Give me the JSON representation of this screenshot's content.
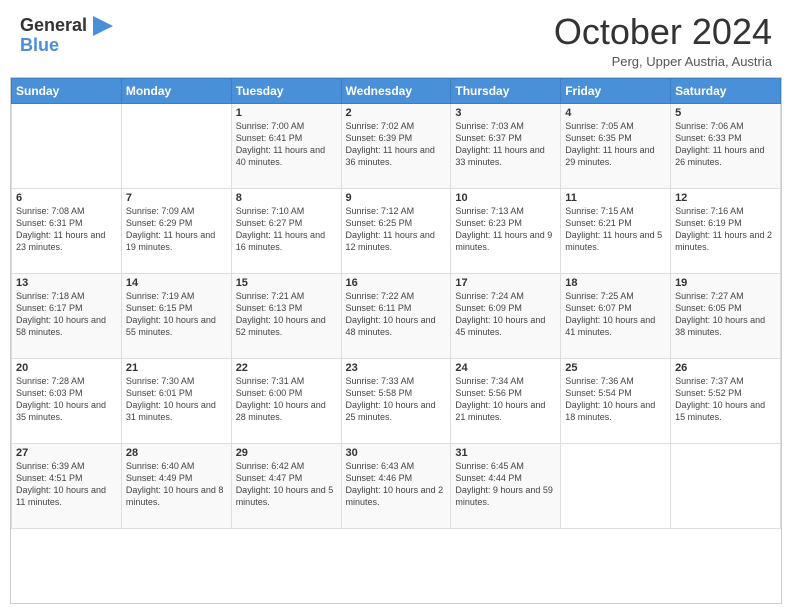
{
  "header": {
    "logo_general": "General",
    "logo_blue": "Blue",
    "title": "October 2024",
    "subtitle": "Perg, Upper Austria, Austria"
  },
  "calendar": {
    "days_of_week": [
      "Sunday",
      "Monday",
      "Tuesday",
      "Wednesday",
      "Thursday",
      "Friday",
      "Saturday"
    ],
    "weeks": [
      [
        {
          "day": "",
          "info": ""
        },
        {
          "day": "",
          "info": ""
        },
        {
          "day": "1",
          "info": "Sunrise: 7:00 AM\nSunset: 6:41 PM\nDaylight: 11 hours and 40 minutes."
        },
        {
          "day": "2",
          "info": "Sunrise: 7:02 AM\nSunset: 6:39 PM\nDaylight: 11 hours and 36 minutes."
        },
        {
          "day": "3",
          "info": "Sunrise: 7:03 AM\nSunset: 6:37 PM\nDaylight: 11 hours and 33 minutes."
        },
        {
          "day": "4",
          "info": "Sunrise: 7:05 AM\nSunset: 6:35 PM\nDaylight: 11 hours and 29 minutes."
        },
        {
          "day": "5",
          "info": "Sunrise: 7:06 AM\nSunset: 6:33 PM\nDaylight: 11 hours and 26 minutes."
        }
      ],
      [
        {
          "day": "6",
          "info": "Sunrise: 7:08 AM\nSunset: 6:31 PM\nDaylight: 11 hours and 23 minutes."
        },
        {
          "day": "7",
          "info": "Sunrise: 7:09 AM\nSunset: 6:29 PM\nDaylight: 11 hours and 19 minutes."
        },
        {
          "day": "8",
          "info": "Sunrise: 7:10 AM\nSunset: 6:27 PM\nDaylight: 11 hours and 16 minutes."
        },
        {
          "day": "9",
          "info": "Sunrise: 7:12 AM\nSunset: 6:25 PM\nDaylight: 11 hours and 12 minutes."
        },
        {
          "day": "10",
          "info": "Sunrise: 7:13 AM\nSunset: 6:23 PM\nDaylight: 11 hours and 9 minutes."
        },
        {
          "day": "11",
          "info": "Sunrise: 7:15 AM\nSunset: 6:21 PM\nDaylight: 11 hours and 5 minutes."
        },
        {
          "day": "12",
          "info": "Sunrise: 7:16 AM\nSunset: 6:19 PM\nDaylight: 11 hours and 2 minutes."
        }
      ],
      [
        {
          "day": "13",
          "info": "Sunrise: 7:18 AM\nSunset: 6:17 PM\nDaylight: 10 hours and 58 minutes."
        },
        {
          "day": "14",
          "info": "Sunrise: 7:19 AM\nSunset: 6:15 PM\nDaylight: 10 hours and 55 minutes."
        },
        {
          "day": "15",
          "info": "Sunrise: 7:21 AM\nSunset: 6:13 PM\nDaylight: 10 hours and 52 minutes."
        },
        {
          "day": "16",
          "info": "Sunrise: 7:22 AM\nSunset: 6:11 PM\nDaylight: 10 hours and 48 minutes."
        },
        {
          "day": "17",
          "info": "Sunrise: 7:24 AM\nSunset: 6:09 PM\nDaylight: 10 hours and 45 minutes."
        },
        {
          "day": "18",
          "info": "Sunrise: 7:25 AM\nSunset: 6:07 PM\nDaylight: 10 hours and 41 minutes."
        },
        {
          "day": "19",
          "info": "Sunrise: 7:27 AM\nSunset: 6:05 PM\nDaylight: 10 hours and 38 minutes."
        }
      ],
      [
        {
          "day": "20",
          "info": "Sunrise: 7:28 AM\nSunset: 6:03 PM\nDaylight: 10 hours and 35 minutes."
        },
        {
          "day": "21",
          "info": "Sunrise: 7:30 AM\nSunset: 6:01 PM\nDaylight: 10 hours and 31 minutes."
        },
        {
          "day": "22",
          "info": "Sunrise: 7:31 AM\nSunset: 6:00 PM\nDaylight: 10 hours and 28 minutes."
        },
        {
          "day": "23",
          "info": "Sunrise: 7:33 AM\nSunset: 5:58 PM\nDaylight: 10 hours and 25 minutes."
        },
        {
          "day": "24",
          "info": "Sunrise: 7:34 AM\nSunset: 5:56 PM\nDaylight: 10 hours and 21 minutes."
        },
        {
          "day": "25",
          "info": "Sunrise: 7:36 AM\nSunset: 5:54 PM\nDaylight: 10 hours and 18 minutes."
        },
        {
          "day": "26",
          "info": "Sunrise: 7:37 AM\nSunset: 5:52 PM\nDaylight: 10 hours and 15 minutes."
        }
      ],
      [
        {
          "day": "27",
          "info": "Sunrise: 6:39 AM\nSunset: 4:51 PM\nDaylight: 10 hours and 11 minutes."
        },
        {
          "day": "28",
          "info": "Sunrise: 6:40 AM\nSunset: 4:49 PM\nDaylight: 10 hours and 8 minutes."
        },
        {
          "day": "29",
          "info": "Sunrise: 6:42 AM\nSunset: 4:47 PM\nDaylight: 10 hours and 5 minutes."
        },
        {
          "day": "30",
          "info": "Sunrise: 6:43 AM\nSunset: 4:46 PM\nDaylight: 10 hours and 2 minutes."
        },
        {
          "day": "31",
          "info": "Sunrise: 6:45 AM\nSunset: 4:44 PM\nDaylight: 9 hours and 59 minutes."
        },
        {
          "day": "",
          "info": ""
        },
        {
          "day": "",
          "info": ""
        }
      ]
    ]
  }
}
